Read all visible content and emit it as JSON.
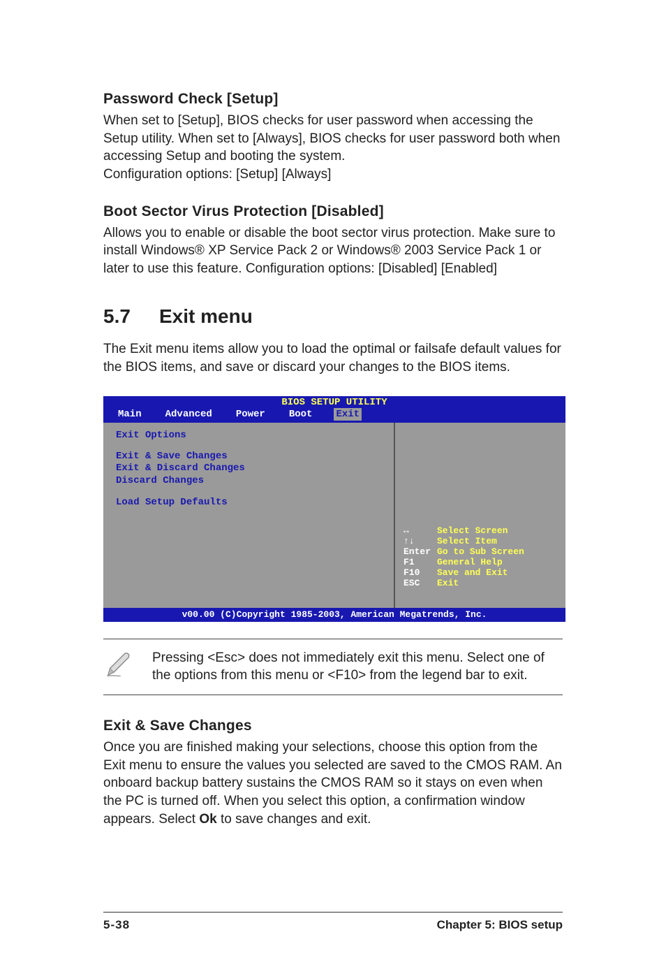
{
  "section1": {
    "heading": "Password Check [Setup]",
    "body": "When set to [Setup], BIOS checks for user password when accessing the Setup utility. When set to [Always], BIOS checks for user password both when accessing Setup and booting the system.\nConfiguration options: [Setup] [Always]"
  },
  "section2": {
    "heading": "Boot Sector Virus Protection [Disabled]",
    "body": "Allows you to enable or disable the boot sector virus protection. Make sure to install Windows® XP Service Pack 2 or Windows® 2003 Service Pack 1 or later to use this feature. Configuration options: [Disabled] [Enabled]"
  },
  "chapter": {
    "num": "5.7",
    "title": "Exit menu",
    "intro": "The Exit menu items allow you to load the optimal or failsafe default values for the BIOS items, and save or discard your changes to the BIOS items."
  },
  "bios": {
    "title": "BIOS SETUP UTILITY",
    "tabs": [
      "Main",
      "Advanced",
      "Power",
      "Boot",
      "Exit"
    ],
    "active_tab": "Exit",
    "left_heading": "Exit Options",
    "items": [
      "Exit & Save Changes",
      "Exit & Discard Changes",
      "Discard Changes",
      "",
      "Load Setup Defaults"
    ],
    "legend": [
      {
        "key": "↔",
        "label": "Select Screen"
      },
      {
        "key": "↑↓",
        "label": "Select Item"
      },
      {
        "key": "Enter",
        "label": "Go to Sub Screen"
      },
      {
        "key": "F1",
        "label": "General Help"
      },
      {
        "key": "F10",
        "label": "Save and Exit"
      },
      {
        "key": "ESC",
        "label": "Exit"
      }
    ],
    "copyright": "v00.00 (C)Copyright 1985-2003, American Megatrends, Inc."
  },
  "note": {
    "text": "Pressing <Esc> does not immediately exit this menu. Select one of the options from this menu or <F10> from the legend bar to exit."
  },
  "section3": {
    "heading": "Exit & Save Changes",
    "body_pre": "Once you are finished making your selections, choose this option from the Exit menu to ensure the values you selected are saved to the CMOS RAM. An onboard backup battery sustains the CMOS RAM so it stays on even when the PC is turned off. When you select this option, a confirmation window appears. Select ",
    "body_bold": "Ok",
    "body_post": " to save changes and exit."
  },
  "footer": {
    "left": "5-38",
    "right": "Chapter 5: BIOS setup"
  }
}
